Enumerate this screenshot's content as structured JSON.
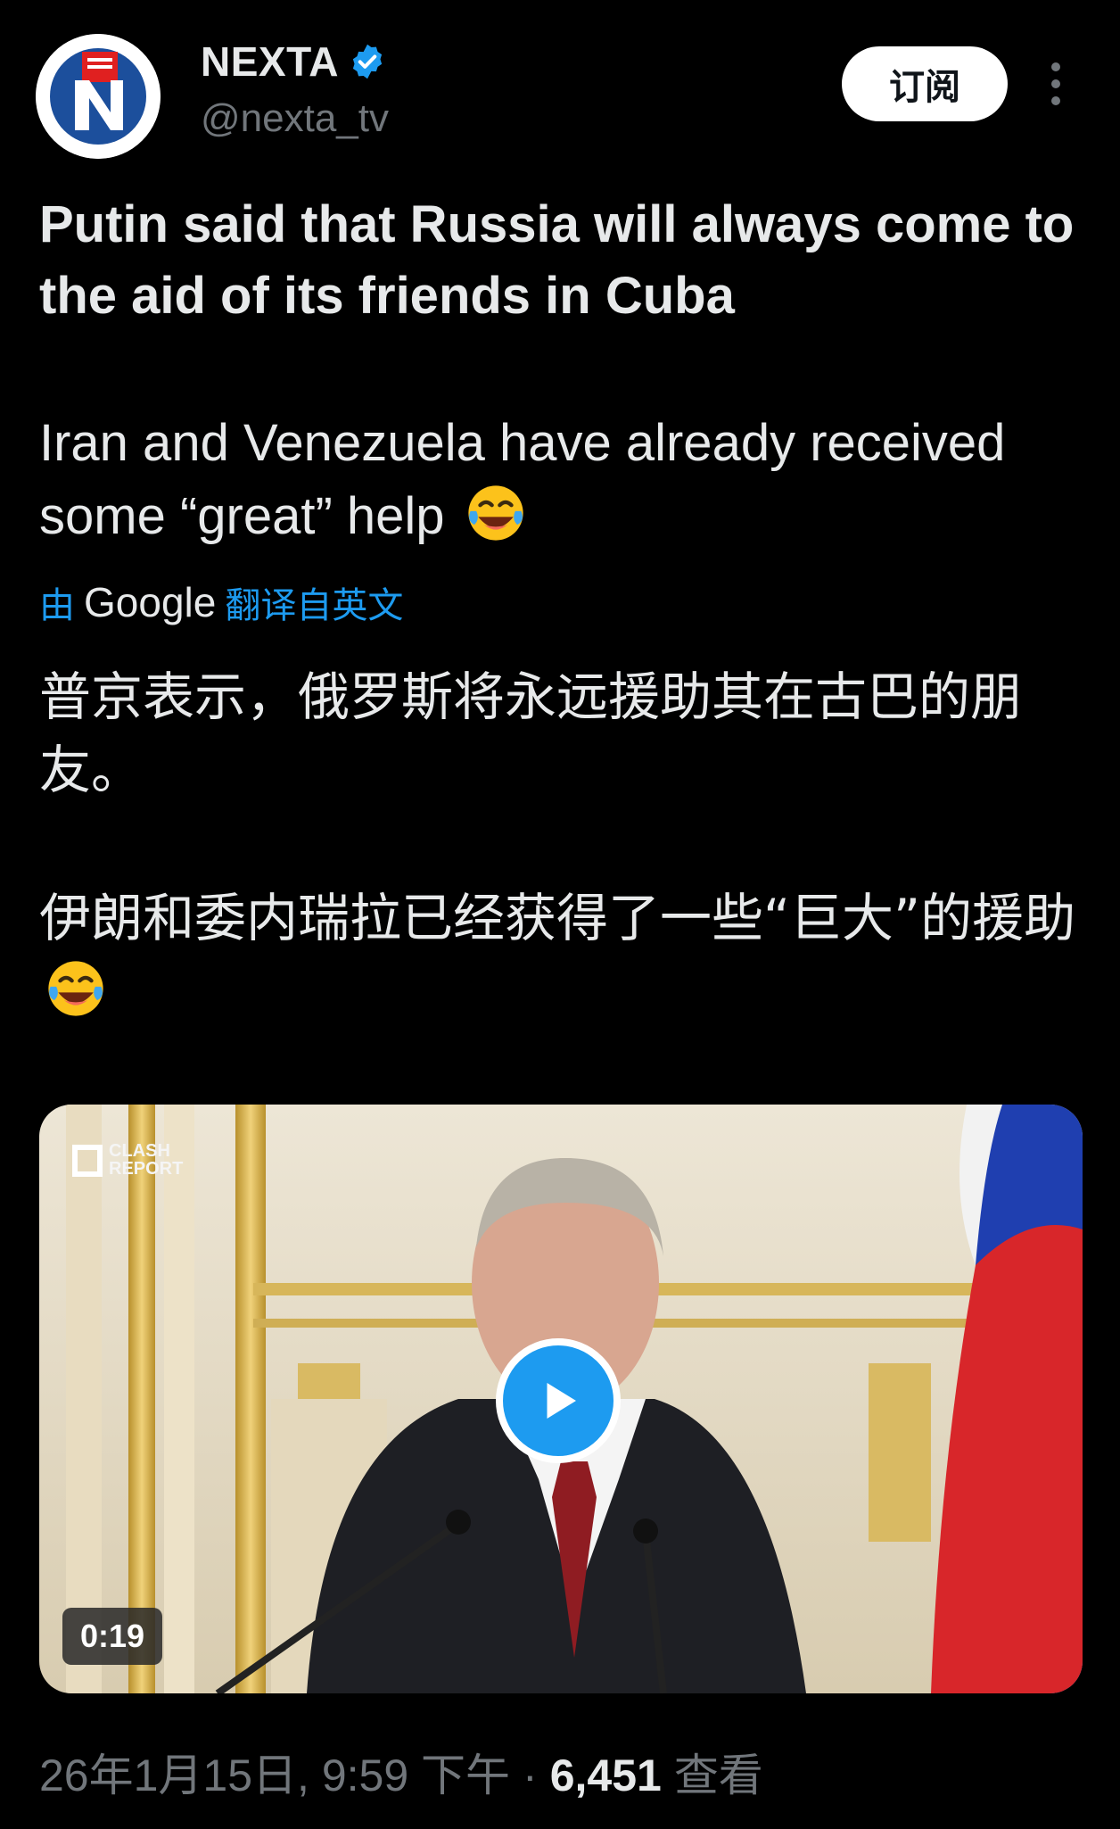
{
  "account": {
    "name": "NEXTA",
    "handle": "@nexta_tv",
    "subscribe_label": "订阅"
  },
  "post": {
    "headline": "Putin said that Russia will always come to the aid of its friends in Cuba",
    "body": "Iran and Venezuela have already received some “great” help",
    "translation": {
      "prefix": "由",
      "provider": "Google",
      "suffix": "翻译自英文",
      "paragraph1": "普京表示，俄罗斯将永远援助其在古巴的朋友。",
      "paragraph2": "伊朗和委内瑞拉已经获得了一些“巨大”的援助"
    },
    "emoji": "face-with-tears-of-joy-icon"
  },
  "media": {
    "duration": "0:19",
    "watermark": "CLASH REPORT"
  },
  "meta": {
    "datetime": "26年1月15日, 9:59 下午",
    "separator": "·",
    "views": "6,451",
    "views_label": "查看"
  },
  "colors": {
    "background": "#000000",
    "text": "#e7e9ea",
    "muted": "#71767b",
    "accent": "#1d9bf0"
  }
}
